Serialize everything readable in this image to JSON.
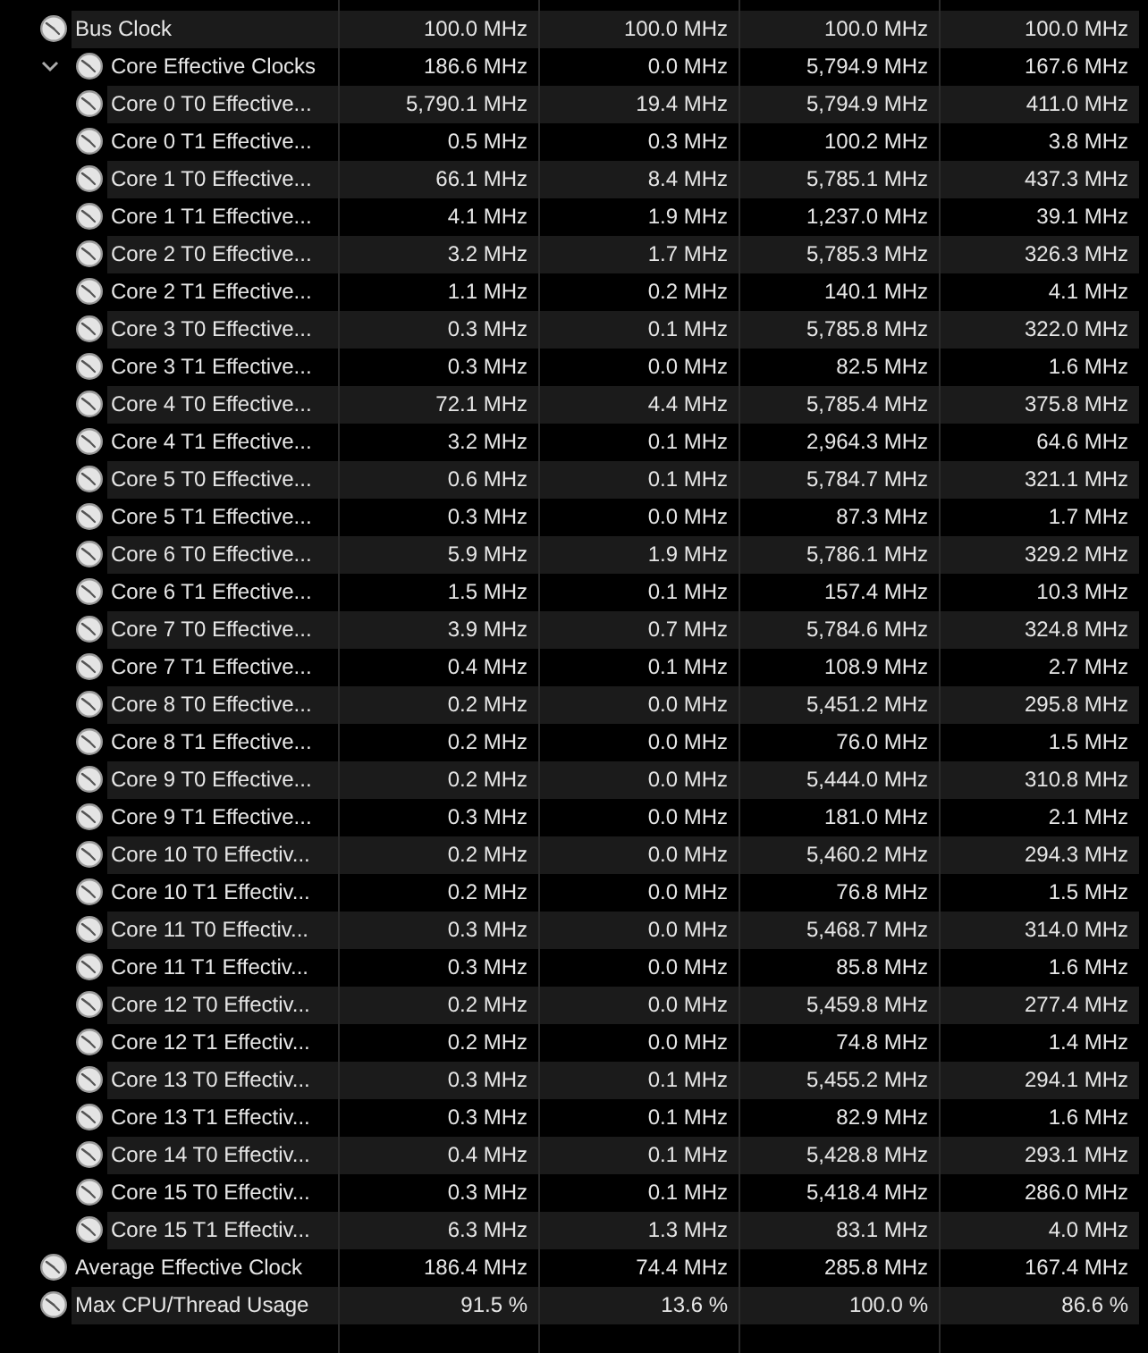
{
  "sensors": [
    {
      "name": "Bus Clock",
      "values": [
        "100.0 MHz",
        "100.0 MHz",
        "100.0 MHz",
        "100.0 MHz"
      ]
    },
    {
      "name": "Core Effective Clocks",
      "values": [
        "186.6 MHz",
        "0.0 MHz",
        "5,794.9 MHz",
        "167.6 MHz"
      ],
      "expanded": true,
      "children": [
        {
          "name": "Core 0 T0 Effective...",
          "values": [
            "5,790.1 MHz",
            "19.4 MHz",
            "5,794.9 MHz",
            "411.0 MHz"
          ]
        },
        {
          "name": "Core 0 T1 Effective...",
          "values": [
            "0.5 MHz",
            "0.3 MHz",
            "100.2 MHz",
            "3.8 MHz"
          ]
        },
        {
          "name": "Core 1 T0 Effective...",
          "values": [
            "66.1 MHz",
            "8.4 MHz",
            "5,785.1 MHz",
            "437.3 MHz"
          ]
        },
        {
          "name": "Core 1 T1 Effective...",
          "values": [
            "4.1 MHz",
            "1.9 MHz",
            "1,237.0 MHz",
            "39.1 MHz"
          ]
        },
        {
          "name": "Core 2 T0 Effective...",
          "values": [
            "3.2 MHz",
            "1.7 MHz",
            "5,785.3 MHz",
            "326.3 MHz"
          ]
        },
        {
          "name": "Core 2 T1 Effective...",
          "values": [
            "1.1 MHz",
            "0.2 MHz",
            "140.1 MHz",
            "4.1 MHz"
          ]
        },
        {
          "name": "Core 3 T0 Effective...",
          "values": [
            "0.3 MHz",
            "0.1 MHz",
            "5,785.8 MHz",
            "322.0 MHz"
          ]
        },
        {
          "name": "Core 3 T1 Effective...",
          "values": [
            "0.3 MHz",
            "0.0 MHz",
            "82.5 MHz",
            "1.6 MHz"
          ]
        },
        {
          "name": "Core 4 T0 Effective...",
          "values": [
            "72.1 MHz",
            "4.4 MHz",
            "5,785.4 MHz",
            "375.8 MHz"
          ]
        },
        {
          "name": "Core 4 T1 Effective...",
          "values": [
            "3.2 MHz",
            "0.1 MHz",
            "2,964.3 MHz",
            "64.6 MHz"
          ]
        },
        {
          "name": "Core 5 T0 Effective...",
          "values": [
            "0.6 MHz",
            "0.1 MHz",
            "5,784.7 MHz",
            "321.1 MHz"
          ]
        },
        {
          "name": "Core 5 T1 Effective...",
          "values": [
            "0.3 MHz",
            "0.0 MHz",
            "87.3 MHz",
            "1.7 MHz"
          ]
        },
        {
          "name": "Core 6 T0 Effective...",
          "values": [
            "5.9 MHz",
            "1.9 MHz",
            "5,786.1 MHz",
            "329.2 MHz"
          ]
        },
        {
          "name": "Core 6 T1 Effective...",
          "values": [
            "1.5 MHz",
            "0.1 MHz",
            "157.4 MHz",
            "10.3 MHz"
          ]
        },
        {
          "name": "Core 7 T0 Effective...",
          "values": [
            "3.9 MHz",
            "0.7 MHz",
            "5,784.6 MHz",
            "324.8 MHz"
          ]
        },
        {
          "name": "Core 7 T1 Effective...",
          "values": [
            "0.4 MHz",
            "0.1 MHz",
            "108.9 MHz",
            "2.7 MHz"
          ]
        },
        {
          "name": "Core 8 T0 Effective...",
          "values": [
            "0.2 MHz",
            "0.0 MHz",
            "5,451.2 MHz",
            "295.8 MHz"
          ]
        },
        {
          "name": "Core 8 T1 Effective...",
          "values": [
            "0.2 MHz",
            "0.0 MHz",
            "76.0 MHz",
            "1.5 MHz"
          ]
        },
        {
          "name": "Core 9 T0 Effective...",
          "values": [
            "0.2 MHz",
            "0.0 MHz",
            "5,444.0 MHz",
            "310.8 MHz"
          ]
        },
        {
          "name": "Core 9 T1 Effective...",
          "values": [
            "0.3 MHz",
            "0.0 MHz",
            "181.0 MHz",
            "2.1 MHz"
          ]
        },
        {
          "name": "Core 10 T0 Effectiv...",
          "values": [
            "0.2 MHz",
            "0.0 MHz",
            "5,460.2 MHz",
            "294.3 MHz"
          ]
        },
        {
          "name": "Core 10 T1 Effectiv...",
          "values": [
            "0.2 MHz",
            "0.0 MHz",
            "76.8 MHz",
            "1.5 MHz"
          ]
        },
        {
          "name": "Core 11 T0 Effectiv...",
          "values": [
            "0.3 MHz",
            "0.0 MHz",
            "5,468.7 MHz",
            "314.0 MHz"
          ]
        },
        {
          "name": "Core 11 T1 Effectiv...",
          "values": [
            "0.3 MHz",
            "0.0 MHz",
            "85.8 MHz",
            "1.6 MHz"
          ]
        },
        {
          "name": "Core 12 T0 Effectiv...",
          "values": [
            "0.2 MHz",
            "0.0 MHz",
            "5,459.8 MHz",
            "277.4 MHz"
          ]
        },
        {
          "name": "Core 12 T1 Effectiv...",
          "values": [
            "0.2 MHz",
            "0.0 MHz",
            "74.8 MHz",
            "1.4 MHz"
          ]
        },
        {
          "name": "Core 13 T0 Effectiv...",
          "values": [
            "0.3 MHz",
            "0.1 MHz",
            "5,455.2 MHz",
            "294.1 MHz"
          ]
        },
        {
          "name": "Core 13 T1 Effectiv...",
          "values": [
            "0.3 MHz",
            "0.1 MHz",
            "82.9 MHz",
            "1.6 MHz"
          ]
        },
        {
          "name": "Core 14 T0 Effectiv...",
          "values": [
            "0.4 MHz",
            "0.1 MHz",
            "5,428.8 MHz",
            "293.1 MHz"
          ]
        },
        {
          "name": "Core 15 T0 Effectiv...",
          "values": [
            "0.3 MHz",
            "0.1 MHz",
            "5,418.4 MHz",
            "286.0 MHz"
          ]
        },
        {
          "name": "Core 15 T1 Effectiv...",
          "values": [
            "6.3 MHz",
            "1.3 MHz",
            "83.1 MHz",
            "4.0 MHz"
          ]
        }
      ]
    },
    {
      "name": "Average Effective Clock",
      "values": [
        "186.4 MHz",
        "74.4 MHz",
        "285.8 MHz",
        "167.4 MHz"
      ]
    },
    {
      "name": "Max CPU/Thread Usage",
      "values": [
        "91.5 %",
        "13.6 %",
        "100.0 %",
        "86.6 %"
      ]
    }
  ]
}
